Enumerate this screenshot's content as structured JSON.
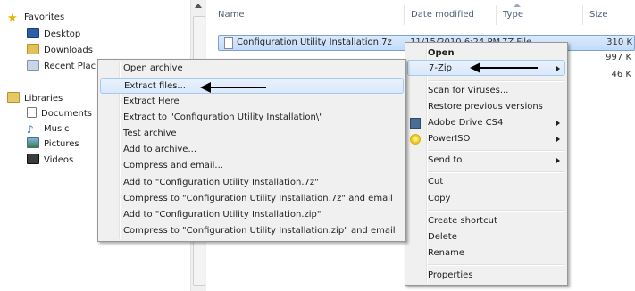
{
  "nav": {
    "favorites": "Favorites",
    "desktop": "Desktop",
    "downloads": "Downloads",
    "recent_places": "Recent Plac",
    "libraries": "Libraries",
    "documents": "Documents",
    "music": "Music",
    "pictures": "Pictures",
    "videos": "Videos"
  },
  "columns": {
    "name": "Name",
    "date_modified": "Date modified",
    "type": "Type",
    "size": "Size"
  },
  "file": {
    "name": "Configuration Utility Installation.7z",
    "date_modified": "11/15/2010 6:24 PM",
    "type": "7Z File",
    "size": "310 K"
  },
  "other_sizes": [
    "997 K",
    "46 K"
  ],
  "shell_menu": {
    "open": "Open",
    "seven_zip": "7-Zip",
    "scan": "Scan for Viruses...",
    "restore": "Restore previous versions",
    "adobe": "Adobe Drive CS4",
    "poweriso": "PowerISO",
    "send_to": "Send to",
    "cut": "Cut",
    "copy": "Copy",
    "create_shortcut": "Create shortcut",
    "delete": "Delete",
    "rename": "Rename",
    "properties": "Properties"
  },
  "zip_menu": {
    "open_archive": "Open archive",
    "extract_files": "Extract files...",
    "extract_here": "Extract Here",
    "extract_to": "Extract to \"Configuration Utility Installation\\\"",
    "test_archive": "Test archive",
    "add_to_archive": "Add to archive...",
    "compress_email": "Compress and email...",
    "add_to_7z": "Add to \"Configuration Utility Installation.7z\"",
    "compress_7z_email": "Compress to \"Configuration Utility Installation.7z\" and email",
    "add_to_zip": "Add to \"Configuration Utility Installation.zip\"",
    "compress_zip_email": "Compress to \"Configuration Utility Installation.zip\" and email"
  },
  "colors": {
    "highlight_border": "#a8c8ec",
    "selection": "#c1dbfc",
    "menu_bg": "#f0f0f0",
    "header_text": "#4c607a"
  }
}
